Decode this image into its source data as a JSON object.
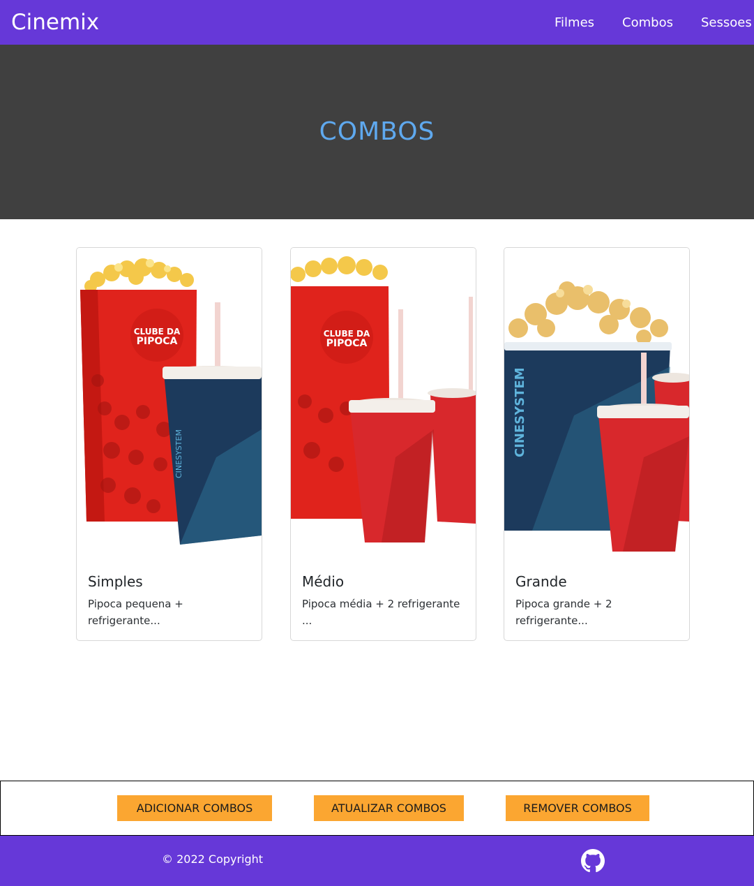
{
  "navbar": {
    "brand": "Cinemix",
    "links": [
      "Filmes",
      "Combos",
      "Sessoes"
    ],
    "background": "#6638d8"
  },
  "hero": {
    "title": "COMBOS",
    "background": "#404040",
    "title_color": "#5fa9ef"
  },
  "combos": [
    {
      "title": "Simples",
      "description": "Pipoca pequena + refrigerante..."
    },
    {
      "title": "Médio",
      "description": "Pipoca média + 2 refrigerante ..."
    },
    {
      "title": "Grande",
      "description": "Pipoca grande + 2 refrigerante..."
    }
  ],
  "actions": {
    "add": "ADICIONAR COMBOS",
    "update": "ATUALIZAR COMBOS",
    "remove": "REMOVER COMBOS",
    "button_color": "#fba631"
  },
  "footer": {
    "copyright": "© 2022 Copyright",
    "icon": "github-icon"
  }
}
